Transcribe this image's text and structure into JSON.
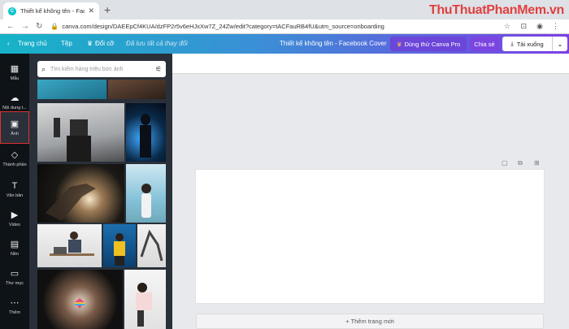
{
  "browser": {
    "tab_title": "Thiết kế không tên - Facebook C",
    "url": "canva.com/design/DAEEpCf4KUA/dzFP2r5v6eHJxXw7Z_24Zw/edit?category=tACFauRB4fU&utm_source=onboarding",
    "watermark": "ThuThuatPhanMem.vn"
  },
  "topbar": {
    "back_label": "Trang chủ",
    "file_label": "Tệp",
    "resize_label": "Đổi cỡ",
    "saved_label": "Đã lưu tất cả thay đổi",
    "design_title": "Thiết kế không tên - Facebook Cover",
    "pro_button": "Dùng thử Canva Pro",
    "share_button": "Chia sẻ",
    "download_button": "Tải xuống"
  },
  "rail": [
    {
      "label": "Mẫu",
      "icon": "template-icon"
    },
    {
      "label": "Nội dung t...",
      "icon": "upload-icon"
    },
    {
      "label": "Ảnh",
      "icon": "photo-icon",
      "active": true
    },
    {
      "label": "Thành phần",
      "icon": "elements-icon"
    },
    {
      "label": "Văn bản",
      "icon": "text-icon"
    },
    {
      "label": "Video",
      "icon": "video-icon"
    },
    {
      "label": "Nền",
      "icon": "background-icon"
    },
    {
      "label": "Thư mục",
      "icon": "folder-icon"
    },
    {
      "label": "Thêm",
      "icon": "more-icon"
    }
  ],
  "panel": {
    "search_placeholder": "Tìm kiếm hàng triệu bức ảnh"
  },
  "canvas": {
    "add_page": "+ Thêm trang mới"
  },
  "colors": {
    "accent_gradient_start": "#16b3c7",
    "accent_gradient_end": "#7b3fe4",
    "rail_bg": "#0e1318",
    "panel_bg": "#293039",
    "active_outline": "#e03030"
  }
}
